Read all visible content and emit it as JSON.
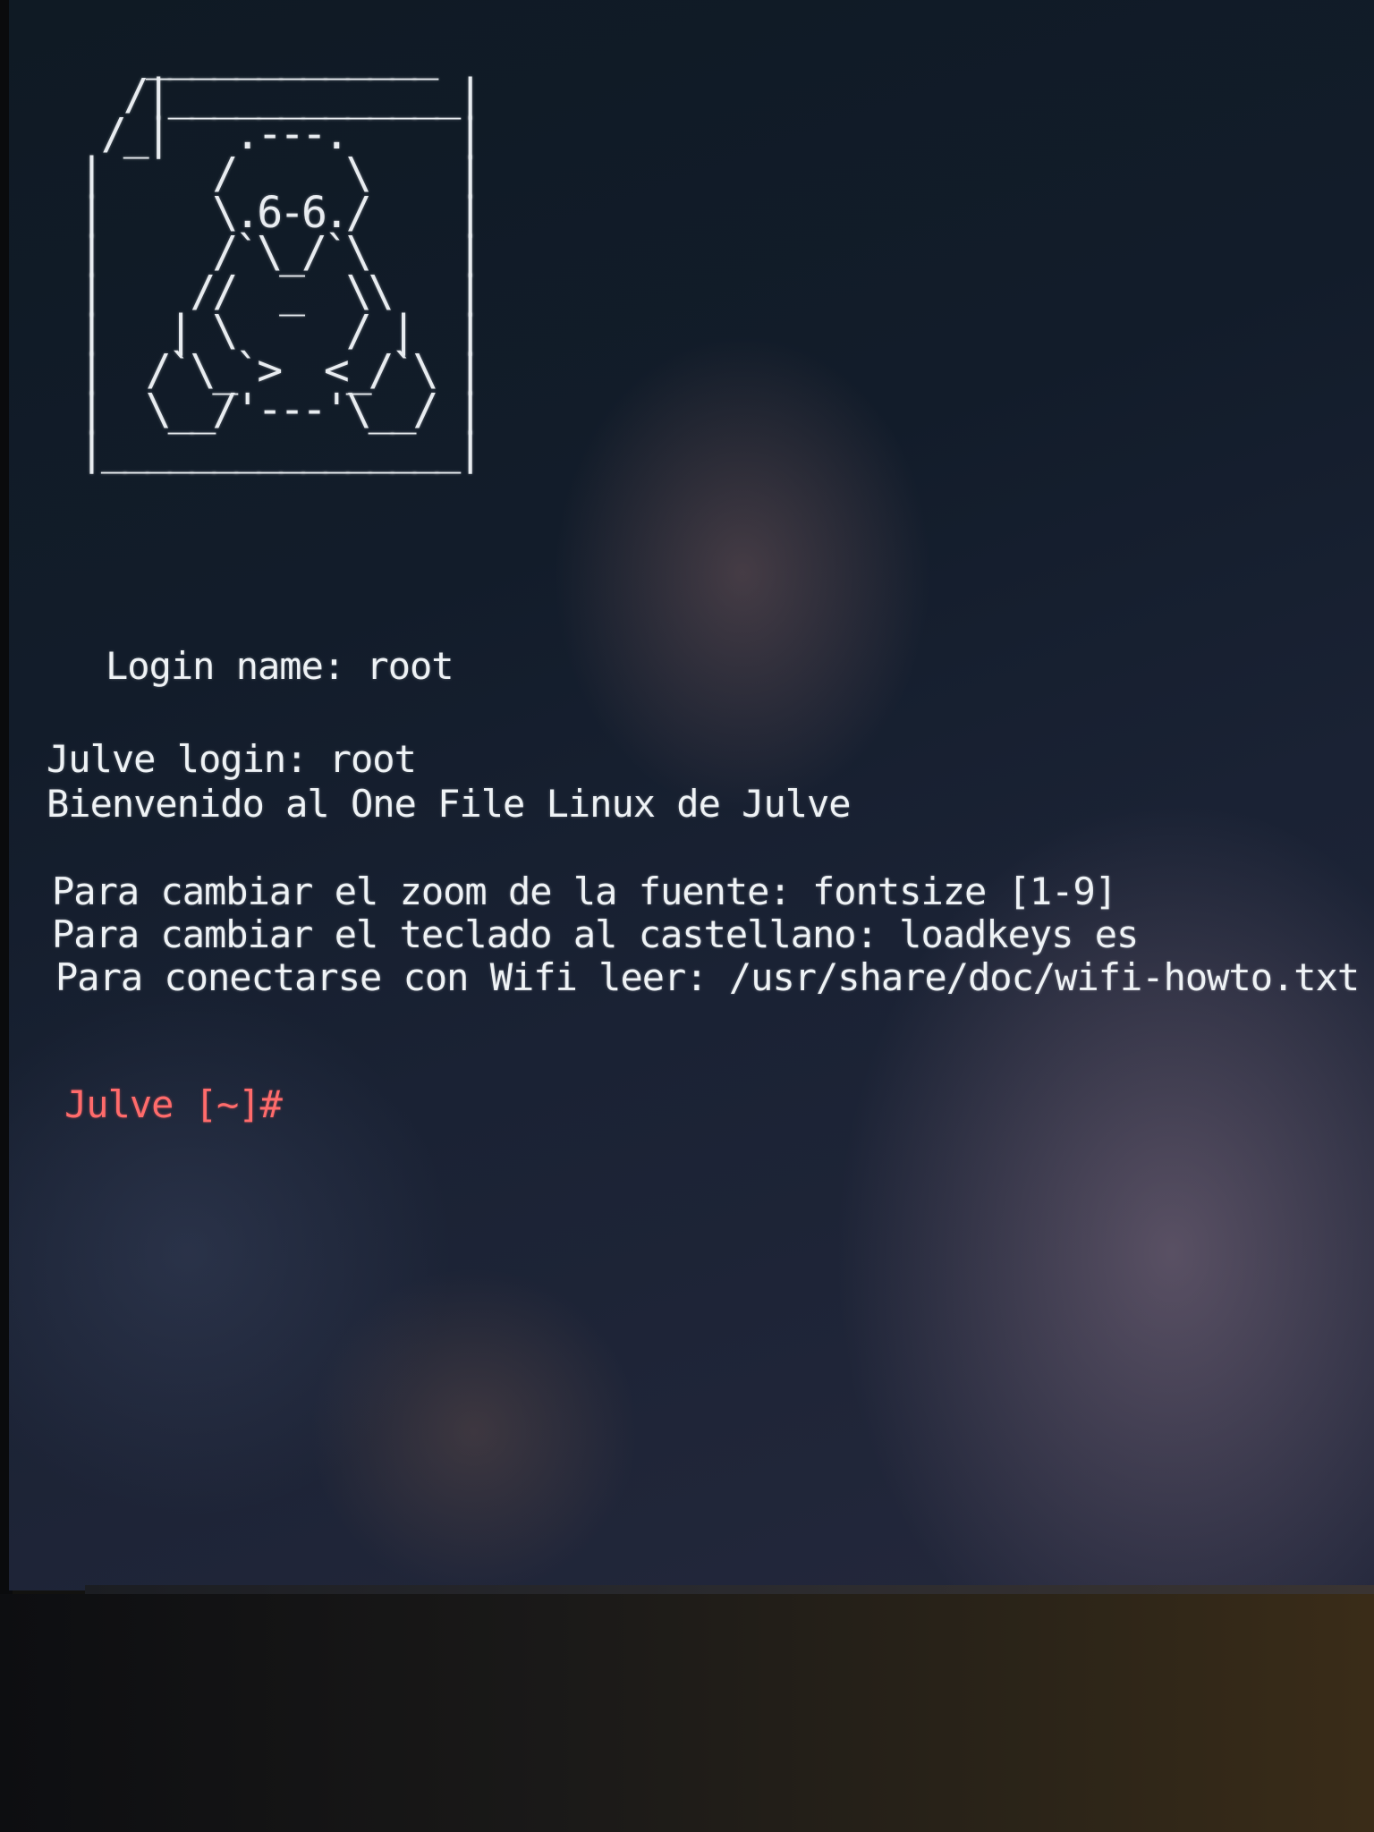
{
  "terminal": {
    "ascii_logo": "   _____________\n  /|_____________|\n /_|   .---.     |\n|     /     \\    |\n|     \\.6-6./    |\n|     /`\\_/`\\    |\n|    //  _  \\\\   |\n|   | \\     / |  |\n|  /`\\_`>  <_/`\\ |\n|  \\__/'---'\\__/ |\n|________________|",
    "login_name_line": "Login name: root",
    "login_line": "Julve login: root",
    "welcome_line": "Bienvenido al One File Linux de Julve",
    "help_lines": [
      "Para cambiar el zoom de la fuente: fontsize [1-9]",
      "Para cambiar el teclado al castellano: loadkeys es",
      "Para conectarse con Wifi leer: /usr/share/doc/wifi-howto.txt"
    ],
    "prompt": "Julve [~]#"
  },
  "colors": {
    "text": "#eef2f5",
    "prompt": "#ff6b6b",
    "background": "#121c2a"
  }
}
